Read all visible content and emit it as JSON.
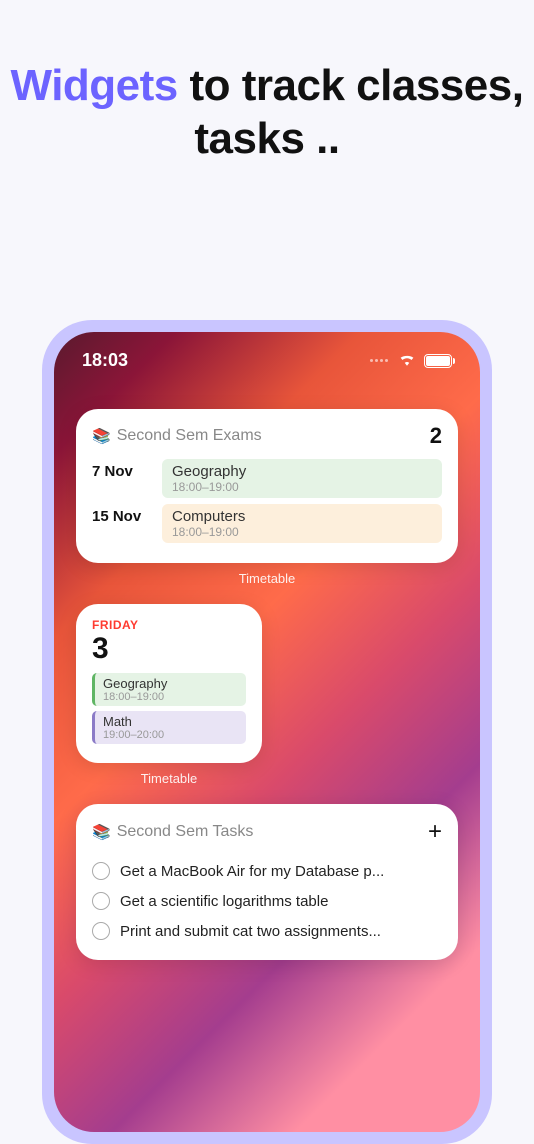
{
  "headline": {
    "accent": "Widgets",
    "rest": " to track classes, tasks .."
  },
  "status": {
    "time": "18:03"
  },
  "exams_widget": {
    "icon": "📚",
    "title": "Second Sem Exams",
    "count": "2",
    "items": [
      {
        "date": "7 Nov",
        "subject": "Geography",
        "time": "18:00–19:00",
        "color": "green"
      },
      {
        "date": "15 Nov",
        "subject": "Computers",
        "time": "18:00–19:00",
        "color": "orange"
      }
    ],
    "caption": "Timetable"
  },
  "day_widget": {
    "weekday": "FRIDAY",
    "day": "3",
    "classes": [
      {
        "subject": "Geography",
        "time": "18:00–19:00",
        "color": "green"
      },
      {
        "subject": "Math",
        "time": "19:00–20:00",
        "color": "purple"
      }
    ],
    "caption": "Timetable"
  },
  "tasks_widget": {
    "icon": "📚",
    "title": "Second Sem Tasks",
    "tasks": [
      "Get a MacBook Air for my Database p...",
      "Get a scientific logarithms table",
      "Print and submit cat two assignments..."
    ]
  }
}
